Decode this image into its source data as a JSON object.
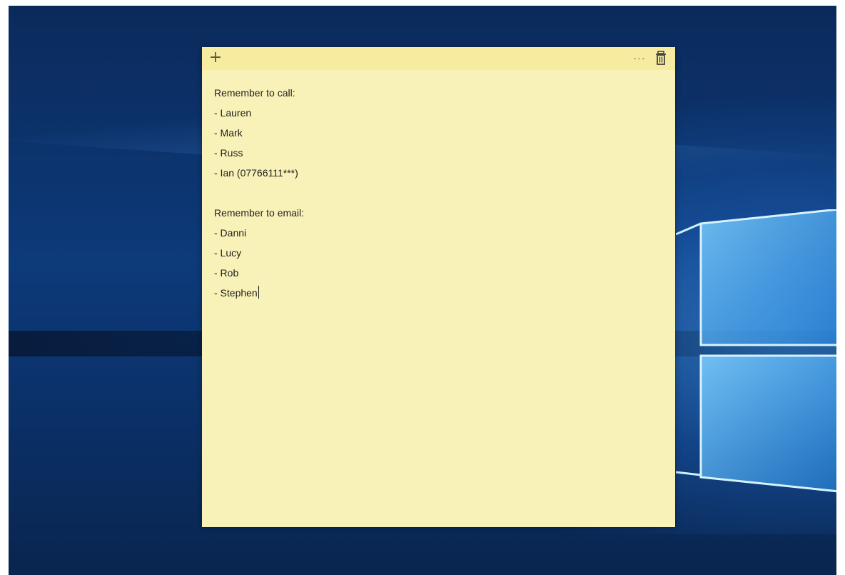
{
  "note": {
    "add_icon": "plus-icon",
    "menu_icon": "more-icon",
    "delete_icon": "trash-icon",
    "add_glyph": "+",
    "menu_glyph": "···",
    "color": "#f9f2b8",
    "header_color": "#f6eb9e",
    "call_heading": "Remember to call:",
    "call_items": [
      "- Lauren",
      "- Mark",
      "- Russ",
      "- Ian (07766111***)"
    ],
    "email_heading": "Remember to email:",
    "email_items": [
      "- Danni",
      "- Lucy",
      "- Rob",
      "- Stephen"
    ]
  }
}
